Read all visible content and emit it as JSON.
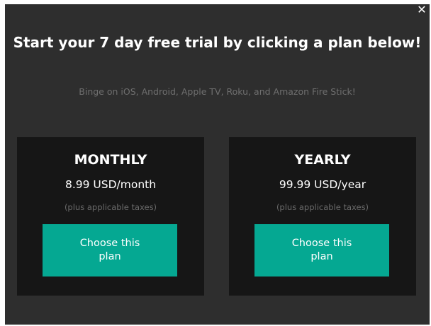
{
  "modal": {
    "close_label": "✕",
    "headline": "Start your 7 day free trial by clicking a plan below!",
    "subline": "Binge on iOS, Android, Apple TV, Roku, and Amazon Fire Stick!"
  },
  "plans": [
    {
      "name": "MONTHLY",
      "price": "8.99 USD/month",
      "tax_note": "(plus applicable taxes)",
      "button_label": "Choose this plan"
    },
    {
      "name": "YEARLY",
      "price": "99.99 USD/year",
      "tax_note": "(plus applicable taxes)",
      "button_label": "Choose this plan"
    }
  ],
  "colors": {
    "modal_background": "#2e2e2e",
    "card_background": "#161616",
    "button_accent": "#05a892"
  }
}
